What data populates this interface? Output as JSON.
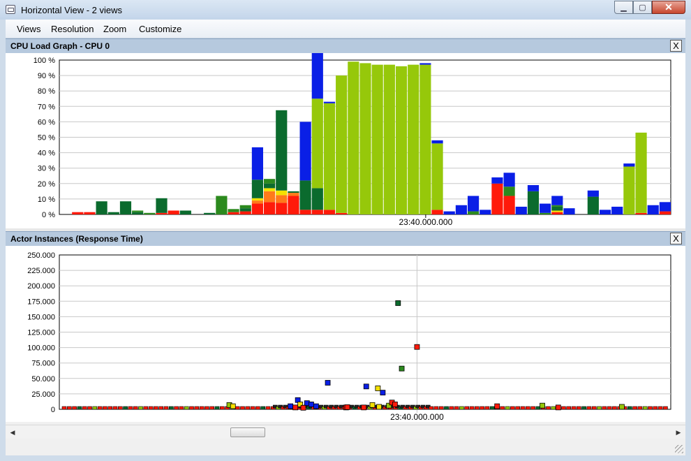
{
  "window": {
    "title": "Horizontal View - 2 views",
    "controls": {
      "minimize": "▁",
      "maximize": "▢",
      "close": "✕"
    }
  },
  "menu": {
    "items": [
      "Views",
      "Resolution",
      "Zoom",
      "Customize"
    ]
  },
  "panel1": {
    "title": "CPU Load Graph - CPU 0",
    "close": "X"
  },
  "panel2": {
    "title": "Actor Instances (Response Time)",
    "close": "X"
  },
  "colors": {
    "red": "#ff1a0a",
    "orange": "#ff7a1a",
    "yellow": "#f4e000",
    "green_dark": "#0b6b2e",
    "green_mid": "#2c8a1e",
    "green_light": "#96c80a",
    "blue": "#0a1fe6",
    "grid": "#c8c8c8"
  },
  "chart_data": [
    {
      "type": "bar",
      "stacked": true,
      "title": "CPU Load Graph - CPU 0",
      "ylim": [
        0,
        100
      ],
      "y_ticks": [
        "0 %",
        "10 %",
        "20 %",
        "30 %",
        "40 %",
        "50 %",
        "60 %",
        "70 %",
        "80 %",
        "90 %",
        "100 %"
      ],
      "x_tick_label": "23:40.000.000",
      "x_tick_bar_index": 30,
      "grid": true,
      "bar_count": 51,
      "series": [
        {
          "color_key": "red",
          "values": [
            0,
            1.5,
            1.5,
            0,
            0,
            0,
            0,
            0,
            1,
            2.5,
            0,
            0,
            0,
            0,
            1.5,
            2,
            7,
            8,
            7.5,
            12,
            3,
            3,
            3,
            1,
            0,
            0,
            0,
            0,
            0,
            0,
            0,
            3,
            0,
            0,
            0,
            0,
            20,
            12,
            0,
            0,
            0,
            1.5,
            0,
            0,
            0,
            0,
            0,
            0,
            1,
            0,
            2
          ]
        },
        {
          "color_key": "orange",
          "values": [
            0,
            0,
            0,
            0,
            0,
            0,
            0,
            0,
            0,
            0,
            0,
            0,
            0,
            0,
            0,
            0,
            2,
            7,
            5,
            2,
            0,
            0,
            0,
            0,
            0,
            0,
            0,
            0,
            0,
            0,
            0,
            0,
            0,
            0,
            0,
            0,
            0,
            0,
            0,
            0,
            0,
            0,
            0,
            0,
            0,
            0,
            0,
            0,
            0,
            0,
            0
          ]
        },
        {
          "color_key": "yellow",
          "values": [
            0,
            0,
            0,
            0,
            0,
            0,
            0,
            0,
            0,
            0,
            0,
            0,
            0,
            0,
            0,
            0,
            1.5,
            2,
            3,
            0,
            0,
            0,
            0,
            0,
            0,
            0,
            0,
            0,
            0,
            0,
            0,
            0,
            0,
            0,
            0,
            0,
            0,
            0,
            0,
            0,
            0,
            1,
            0,
            0,
            0,
            0,
            0,
            0,
            0,
            0,
            0
          ]
        },
        {
          "color_key": "green_dark",
          "values": [
            0,
            0,
            0,
            8.5,
            1.5,
            8.5,
            1.5,
            0,
            9.5,
            0,
            2.5,
            0,
            1,
            0,
            0,
            2,
            12,
            3,
            52,
            1,
            19,
            14,
            0,
            0,
            0,
            0,
            0,
            0,
            0,
            0,
            0,
            0,
            0,
            0,
            0,
            0,
            0,
            0,
            0,
            15,
            0,
            2.5,
            0,
            0,
            11.5,
            0,
            0,
            0,
            0,
            0,
            0
          ]
        },
        {
          "color_key": "green_mid",
          "values": [
            0,
            0,
            0,
            0,
            0,
            0,
            1,
            1,
            0,
            0,
            0,
            0,
            0,
            12,
            2,
            2,
            0,
            3,
            0,
            0,
            0,
            0,
            0,
            0,
            0,
            0,
            0,
            0,
            0,
            0,
            0,
            0,
            0,
            0,
            2,
            0,
            0,
            6,
            0,
            0,
            1,
            1,
            0,
            0,
            0,
            0,
            0,
            0,
            0,
            0,
            0
          ]
        },
        {
          "color_key": "green_light",
          "values": [
            0,
            0,
            0,
            0,
            0,
            0,
            0,
            0,
            0,
            0,
            0,
            0,
            0,
            0,
            0,
            0,
            0,
            0,
            0,
            0,
            0,
            58,
            69,
            89,
            99,
            98,
            97,
            97,
            96,
            97,
            97,
            43,
            0,
            0,
            0,
            0,
            0,
            0,
            0,
            0,
            0,
            0,
            0,
            0,
            0,
            0,
            0,
            31,
            52,
            0,
            0
          ]
        },
        {
          "color_key": "blue",
          "values": [
            0,
            0,
            0,
            0,
            0,
            0,
            0,
            0,
            0,
            0,
            0,
            0,
            0,
            0,
            0,
            0,
            21,
            0,
            0,
            0,
            38,
            79,
            1,
            0,
            0,
            0,
            0,
            0,
            0,
            0,
            1,
            2,
            2,
            6,
            10,
            3,
            4,
            9,
            5,
            4,
            6,
            6,
            4,
            0,
            4,
            3,
            5,
            2,
            0,
            6,
            6
          ]
        }
      ]
    },
    {
      "type": "scatter",
      "title": "Actor Instances (Response Time)",
      "ylim": [
        0,
        250000
      ],
      "y_ticks": [
        "0",
        "25.000",
        "50.000",
        "75.000",
        "100.000",
        "125.000",
        "150.000",
        "175.000",
        "200.000",
        "225.000",
        "250.000"
      ],
      "x_tick_label": "23:40.000.000",
      "x_range": [
        0,
        100
      ],
      "x_tick_value": 58.5,
      "grid": true,
      "points": [
        {
          "x": 39.0,
          "y": 15000,
          "color_key": "blue"
        },
        {
          "x": 37.8,
          "y": 5000,
          "color_key": "blue"
        },
        {
          "x": 40.5,
          "y": 10000,
          "color_key": "blue"
        },
        {
          "x": 41.2,
          "y": 8000,
          "color_key": "blue"
        },
        {
          "x": 42.0,
          "y": 5000,
          "color_key": "blue"
        },
        {
          "x": 39.4,
          "y": 8000,
          "color_key": "yellow"
        },
        {
          "x": 38.6,
          "y": 3000,
          "color_key": "red"
        },
        {
          "x": 39.9,
          "y": 2500,
          "color_key": "red"
        },
        {
          "x": 43.9,
          "y": 43000,
          "color_key": "blue"
        },
        {
          "x": 46.9,
          "y": 3000,
          "color_key": "red"
        },
        {
          "x": 47.1,
          "y": 3500,
          "color_key": "red"
        },
        {
          "x": 50.2,
          "y": 37000,
          "color_key": "blue"
        },
        {
          "x": 49.8,
          "y": 3000,
          "color_key": "red"
        },
        {
          "x": 51.2,
          "y": 7000,
          "color_key": "yellow"
        },
        {
          "x": 52.1,
          "y": 34000,
          "color_key": "yellow"
        },
        {
          "x": 52.9,
          "y": 27000,
          "color_key": "blue"
        },
        {
          "x": 52.3,
          "y": 4000,
          "color_key": "yellow"
        },
        {
          "x": 53.9,
          "y": 6000,
          "color_key": "green_light"
        },
        {
          "x": 54.4,
          "y": 11000,
          "color_key": "red"
        },
        {
          "x": 54.9,
          "y": 8000,
          "color_key": "red"
        },
        {
          "x": 55.4,
          "y": 172000,
          "color_key": "green_dark"
        },
        {
          "x": 56.0,
          "y": 66000,
          "color_key": "green_mid"
        },
        {
          "x": 58.5,
          "y": 101000,
          "color_key": "red"
        },
        {
          "x": 27.8,
          "y": 7000,
          "color_key": "green_light"
        },
        {
          "x": 28.4,
          "y": 5000,
          "color_key": "yellow"
        },
        {
          "x": 71.6,
          "y": 5000,
          "color_key": "red"
        },
        {
          "x": 79.0,
          "y": 6000,
          "color_key": "green_light"
        },
        {
          "x": 92.0,
          "y": 4000,
          "color_key": "green_light"
        },
        {
          "x": 81.6,
          "y": 3000,
          "color_key": "red"
        }
      ],
      "baseline_markers": true
    }
  ]
}
